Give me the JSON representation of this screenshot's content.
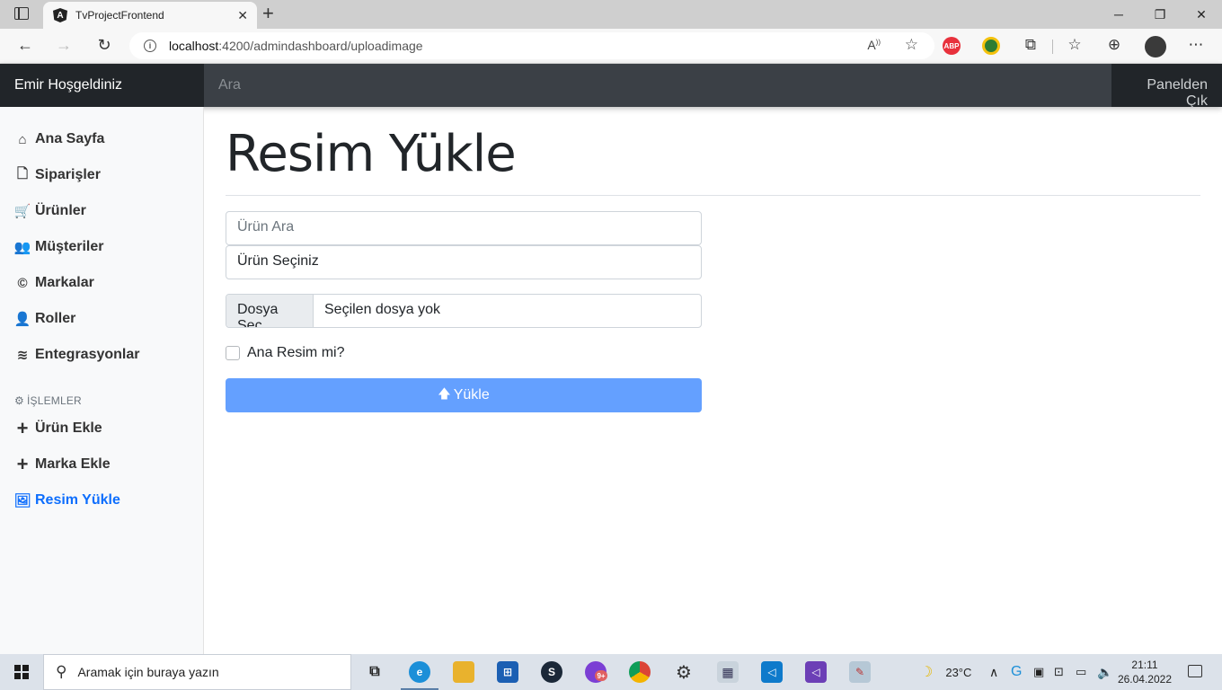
{
  "browser": {
    "tab_title": "TvProjectFrontend",
    "tab_favicon_letter": "A",
    "url_host": "localhost",
    "url_rest": ":4200/admindashboard/uploadimage",
    "window_controls": [
      "─",
      "❐",
      "✕"
    ],
    "extensions": [
      {
        "name": "adblock-plus-icon",
        "label": "ABP",
        "color": "#e8313c"
      },
      {
        "name": "extension-globe-icon",
        "label": "",
        "color": "#2e7d32"
      }
    ]
  },
  "navbar": {
    "brand": "Emir Hoşgeldiniz",
    "search_placeholder": "Ara",
    "signout": "Panelden Çık"
  },
  "sidebar": {
    "items": [
      {
        "label": "Ana Sayfa",
        "icon": "home-icon",
        "glyph": "⌂"
      },
      {
        "label": "Siparişler",
        "icon": "file-icon",
        "glyph": "🗋"
      },
      {
        "label": "Ürünler",
        "icon": "shopping-cart-icon",
        "glyph": "🛒"
      },
      {
        "label": "Müşteriler",
        "icon": "users-icon",
        "glyph": "👥"
      },
      {
        "label": "Markalar",
        "icon": "copyright-icon",
        "glyph": "©"
      },
      {
        "label": "Roller",
        "icon": "user-lock-icon",
        "glyph": "👤"
      },
      {
        "label": "Entegrasyonlar",
        "icon": "layers-icon",
        "glyph": "≋"
      }
    ],
    "section_heading": "İŞLEMLER",
    "section_items": [
      {
        "label": "Ürün Ekle",
        "icon": "plus-icon",
        "glyph": "+"
      },
      {
        "label": "Marka Ekle",
        "icon": "plus-icon",
        "glyph": "+"
      },
      {
        "label": "Resim Yükle",
        "icon": "image-icon",
        "glyph": "🖼",
        "active": true
      }
    ]
  },
  "main": {
    "title": "Resim Yükle",
    "product_search_placeholder": "Ürün Ara",
    "product_select_value": "Ürün Seçiniz",
    "file_button": "Dosya Seç",
    "file_status": "Seçilen dosya yok",
    "main_image_checkbox_label": "Ana Resim mi?",
    "main_image_checked": false,
    "submit_label": "Yükle"
  },
  "taskbar": {
    "search_placeholder": "Aramak için buraya yazın",
    "weather_temp": "23°C",
    "time": "21:11",
    "date": "26.04.2022",
    "badge": "9+"
  }
}
